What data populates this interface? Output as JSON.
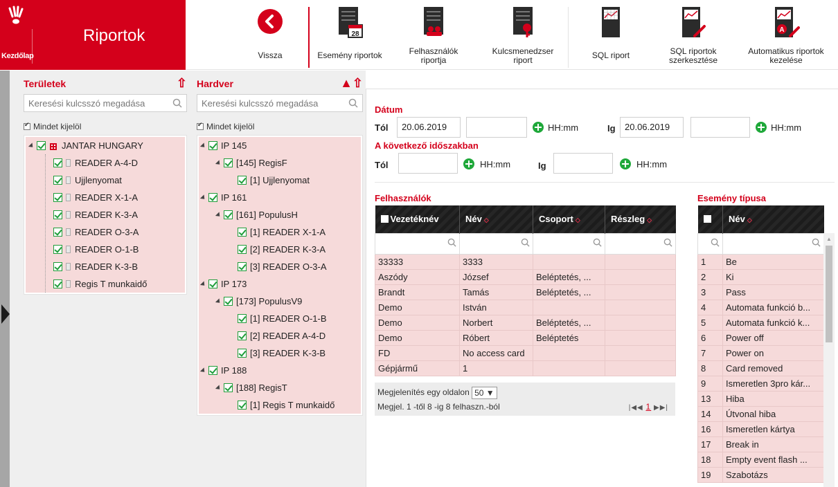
{
  "brand": {
    "home_label": "Kezdőlap",
    "title": "Riportok"
  },
  "toolbar": [
    {
      "key": "back",
      "label": "Vissza"
    },
    {
      "key": "event",
      "label": "Esemény riportok"
    },
    {
      "key": "users",
      "label": "Felhasználók riportja"
    },
    {
      "key": "keymgr",
      "label": "Kulcsmenedzser riport"
    },
    {
      "key": "sql",
      "label": "SQL riport"
    },
    {
      "key": "sqledit",
      "label": "SQL riportok szerkesztése"
    },
    {
      "key": "auto",
      "label": "Automatikus riportok kezelése"
    }
  ],
  "icons": {
    "calendar_day": "28"
  },
  "areas": {
    "title": "Területek",
    "search_placeholder": "Keresési kulcsszó megadása",
    "select_all": "Mindet kijelöl",
    "nodes": [
      {
        "label": "JANTAR HUNGARY",
        "level": 0,
        "type": "org"
      },
      {
        "label": "READER A-4-D",
        "level": 1,
        "type": "dev"
      },
      {
        "label": "Ujjlenyomat",
        "level": 1,
        "type": "dev"
      },
      {
        "label": "READER X-1-A",
        "level": 1,
        "type": "dev"
      },
      {
        "label": "READER K-3-A",
        "level": 1,
        "type": "dev"
      },
      {
        "label": "READER O-3-A",
        "level": 1,
        "type": "dev"
      },
      {
        "label": "READER O-1-B",
        "level": 1,
        "type": "dev"
      },
      {
        "label": "READER K-3-B",
        "level": 1,
        "type": "dev"
      },
      {
        "label": "Regis T munkaidő",
        "level": 1,
        "type": "dev"
      }
    ]
  },
  "hardware": {
    "title": "Hardver",
    "search_placeholder": "Keresési kulcsszó megadása",
    "select_all": "Mindet kijelöl",
    "nodes": [
      {
        "label": "IP 145",
        "level": 0
      },
      {
        "label": "[145] RegisF",
        "level": 1
      },
      {
        "label": "[1] Ujjlenyomat",
        "level": 2
      },
      {
        "label": "IP 161",
        "level": 0
      },
      {
        "label": "[161] PopulusH",
        "level": 1
      },
      {
        "label": "[1] READER X-1-A",
        "level": 2
      },
      {
        "label": "[2] READER K-3-A",
        "level": 2
      },
      {
        "label": "[3] READER O-3-A",
        "level": 2
      },
      {
        "label": "IP 173",
        "level": 0
      },
      {
        "label": "[173] PopulusV9",
        "level": 1
      },
      {
        "label": "[1] READER O-1-B",
        "level": 2
      },
      {
        "label": "[2] READER A-4-D",
        "level": 2
      },
      {
        "label": "[3] READER K-3-B",
        "level": 2
      },
      {
        "label": "IP 188",
        "level": 0
      },
      {
        "label": "[188] RegisT",
        "level": 1
      },
      {
        "label": "[1] Regis T munkaidő",
        "level": 2
      }
    ]
  },
  "date": {
    "title": "Dátum",
    "from_label": "Tól",
    "from_value": "20.06.2019",
    "to_label": "Ig",
    "to_value": "20.06.2019",
    "hhmm": "HH:mm",
    "next_period_title": "A következő időszakban"
  },
  "users": {
    "title": "Felhasználók",
    "columns": [
      "Vezetéknév",
      "Név",
      "Csoport",
      "Részleg"
    ],
    "rows": [
      [
        "33333",
        "3333",
        "",
        ""
      ],
      [
        "Aszódy",
        "József",
        "Beléptetés, ...",
        ""
      ],
      [
        "Brandt",
        "Tamás",
        "Beléptetés, ...",
        ""
      ],
      [
        "Demo",
        "István",
        "",
        ""
      ],
      [
        "Demo",
        "Norbert",
        "Beléptetés, ...",
        ""
      ],
      [
        "Demo",
        "Róbert",
        "Beléptetés",
        ""
      ],
      [
        "FD",
        "No access card",
        "",
        ""
      ],
      [
        "Gépjármű",
        "1",
        "",
        ""
      ]
    ],
    "per_page_label": "Megjelenítés egy oldalon",
    "per_page_value": "50 ▼",
    "summary": "Megjel. 1 -től 8 -ig 8 felhaszn.-ból",
    "page": "1"
  },
  "event_types": {
    "title": "Esemény típusa",
    "name_col": "Név",
    "rows": [
      [
        "1",
        "Be"
      ],
      [
        "2",
        "Ki"
      ],
      [
        "3",
        "Pass"
      ],
      [
        "4",
        "Automata funkció b..."
      ],
      [
        "5",
        "Automata funkció k..."
      ],
      [
        "6",
        "Power off"
      ],
      [
        "7",
        "Power on"
      ],
      [
        "8",
        "Card removed"
      ],
      [
        "9",
        "Ismeretlen 3pro kár..."
      ],
      [
        "13",
        "Hiba"
      ],
      [
        "14",
        "Útvonal hiba"
      ],
      [
        "16",
        "Ismeretlen kártya"
      ],
      [
        "17",
        "Break in"
      ],
      [
        "18",
        "Empty event flash ..."
      ],
      [
        "19",
        "Szabotázs"
      ]
    ]
  },
  "colors": {
    "brand_red": "#d4001b",
    "row_pink": "#f6dada",
    "check_green": "#1f9d3a"
  }
}
